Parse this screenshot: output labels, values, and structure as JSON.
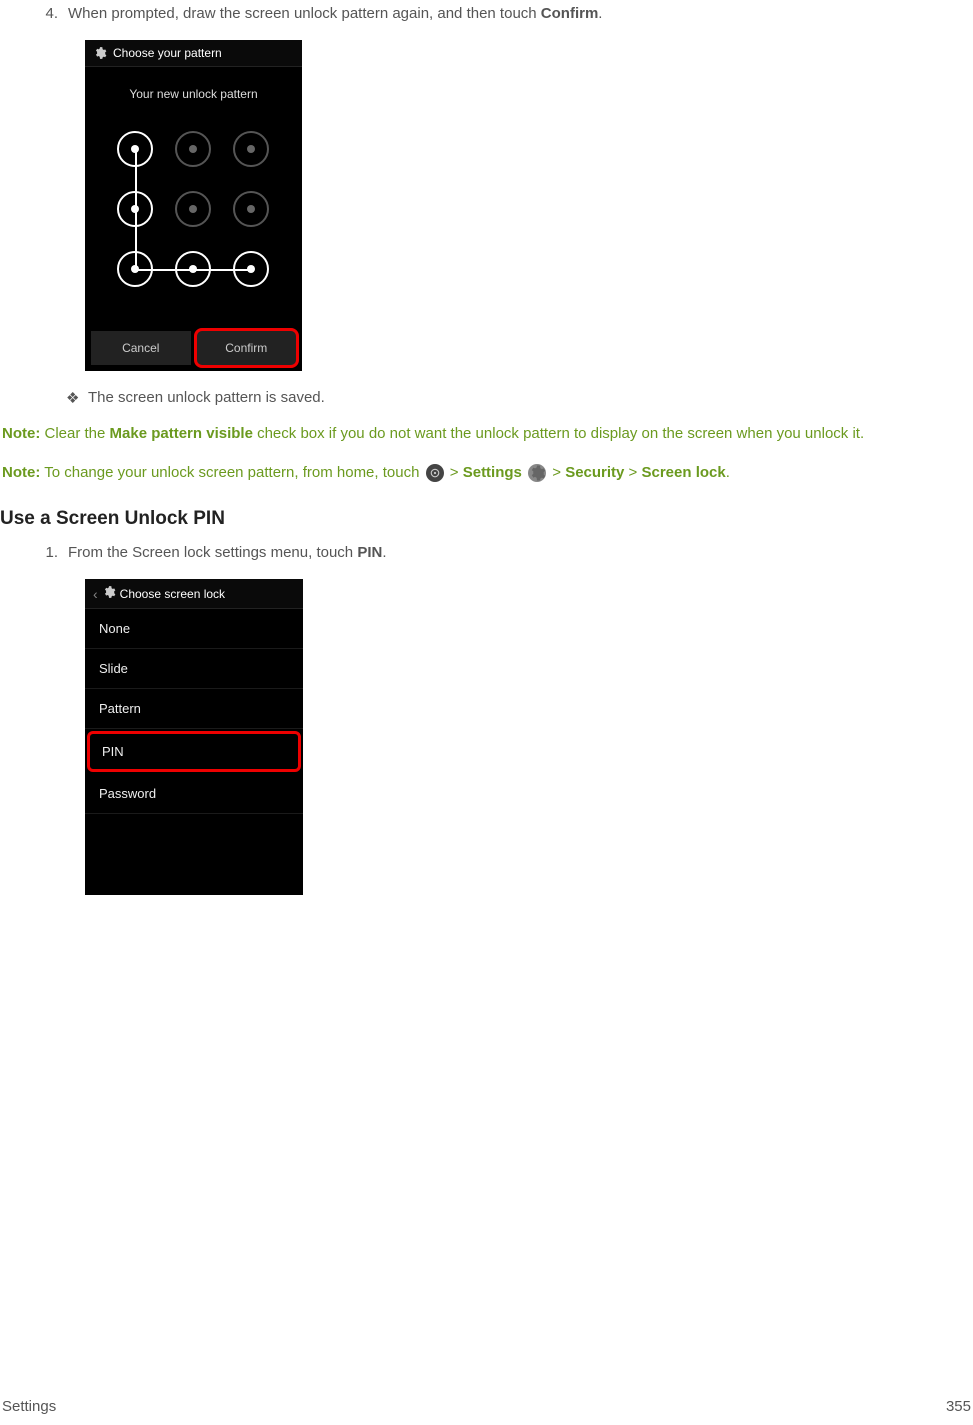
{
  "step4": {
    "number": "4.",
    "text_before": "When prompted, draw the screen unlock pattern again, and then touch ",
    "bold_word": "Confirm",
    "text_after": "."
  },
  "screenshot1": {
    "header": "Choose your pattern",
    "subheader": "Your new unlock pattern",
    "cancel": "Cancel",
    "confirm": "Confirm"
  },
  "bullet": {
    "mark": "❖",
    "text": "The screen unlock pattern is saved."
  },
  "note1": {
    "prefix": "Note:",
    "text_1": " Clear the ",
    "bold_1": "Make pattern visible",
    "text_2": " check box if you do not want the unlock pattern to display on the screen when you unlock it."
  },
  "note2": {
    "prefix": "Note:",
    "text_1": " To change your unlock screen pattern, from home, touch ",
    "gt1": " > ",
    "bold_1": "Settings",
    "gt2": " > ",
    "bold_2": "Security",
    "gt3": " > ",
    "bold_3": "Screen lock",
    "text_end": "."
  },
  "section_heading": "Use a Screen Unlock PIN",
  "step1": {
    "number": "1.",
    "text_before": "From the Screen lock settings menu, touch ",
    "bold_word": "PIN",
    "text_after": "."
  },
  "screenshot2": {
    "header": "Choose screen lock",
    "items": [
      "None",
      "Slide",
      "Pattern",
      "PIN",
      "Password"
    ],
    "highlighted_index": 3
  },
  "footer": {
    "left": "Settings",
    "right": "355"
  }
}
